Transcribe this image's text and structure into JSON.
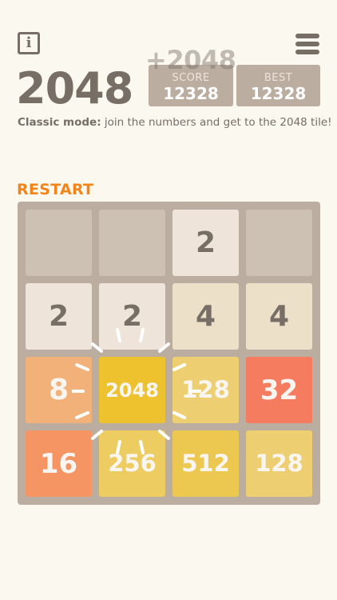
{
  "header": {
    "info_icon_glyph": "i",
    "menu_icon": "hamburger-icon",
    "title": "2048",
    "score_delta": "+2048",
    "score_label": "SCORE",
    "score_value": "12328",
    "best_label": "BEST",
    "best_value": "12328"
  },
  "subtitle": {
    "mode": "Classic mode:",
    "text": " join the numbers and get to the 2048 tile!"
  },
  "restart_label": "RESTART",
  "board": {
    "rows": [
      [
        null,
        null,
        2,
        null
      ],
      [
        2,
        2,
        4,
        4
      ],
      [
        8,
        2048,
        128,
        32
      ],
      [
        16,
        256,
        512,
        128
      ]
    ],
    "highlight_tile": "2048"
  },
  "colors": {
    "background": "#fbf8ef",
    "board": "#bbada0",
    "empty": "#cdc1b4",
    "text_dark": "#776e65",
    "accent": "#f2841a"
  }
}
